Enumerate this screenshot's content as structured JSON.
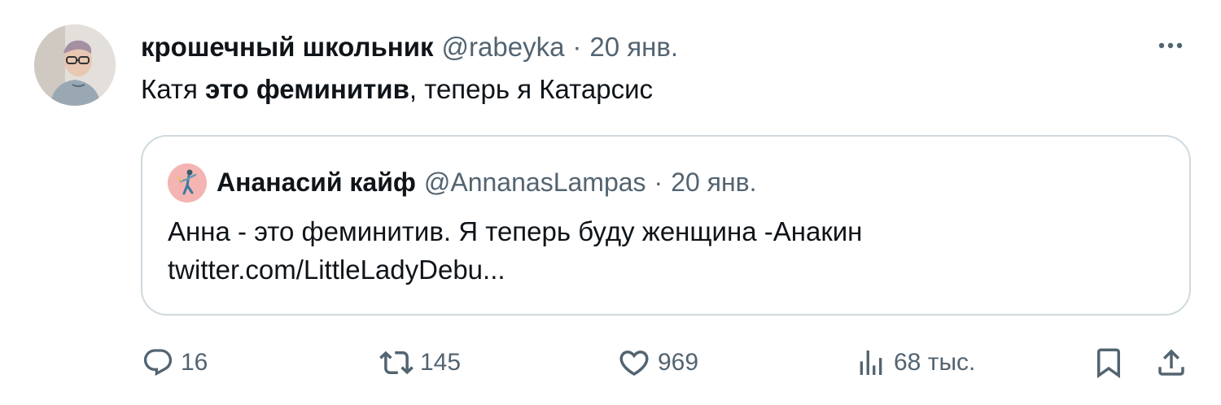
{
  "tweet": {
    "author": {
      "display_name": "крошечный школьник",
      "handle": "@rabeyka",
      "separator": "·",
      "date": "20 янв."
    },
    "text": {
      "part1": "Катя ",
      "bold": "это феминитив",
      "part2": ", теперь я Катарсис"
    },
    "more_icon": "more-horizontal-icon"
  },
  "quoted_tweet": {
    "author": {
      "display_name": "Ананасий кайф",
      "handle": "@AnnanasLampas",
      "separator": "·",
      "date": "20 янв."
    },
    "text_line1": "Анна - это феминитив. Я теперь буду женщина -Анакин",
    "text_line2": "twitter.com/LittleLadyDebu..."
  },
  "actions": {
    "replies": "16",
    "retweets": "145",
    "likes": "969",
    "views": "68 тыс.",
    "icons": {
      "reply": "reply-icon",
      "retweet": "retweet-icon",
      "like": "heart-icon",
      "views": "views-icon",
      "bookmark": "bookmark-icon",
      "share": "share-icon"
    }
  },
  "colors": {
    "text_primary": "#0f1419",
    "text_secondary": "#536471",
    "border": "#cfd9de",
    "background": "#ffffff"
  }
}
